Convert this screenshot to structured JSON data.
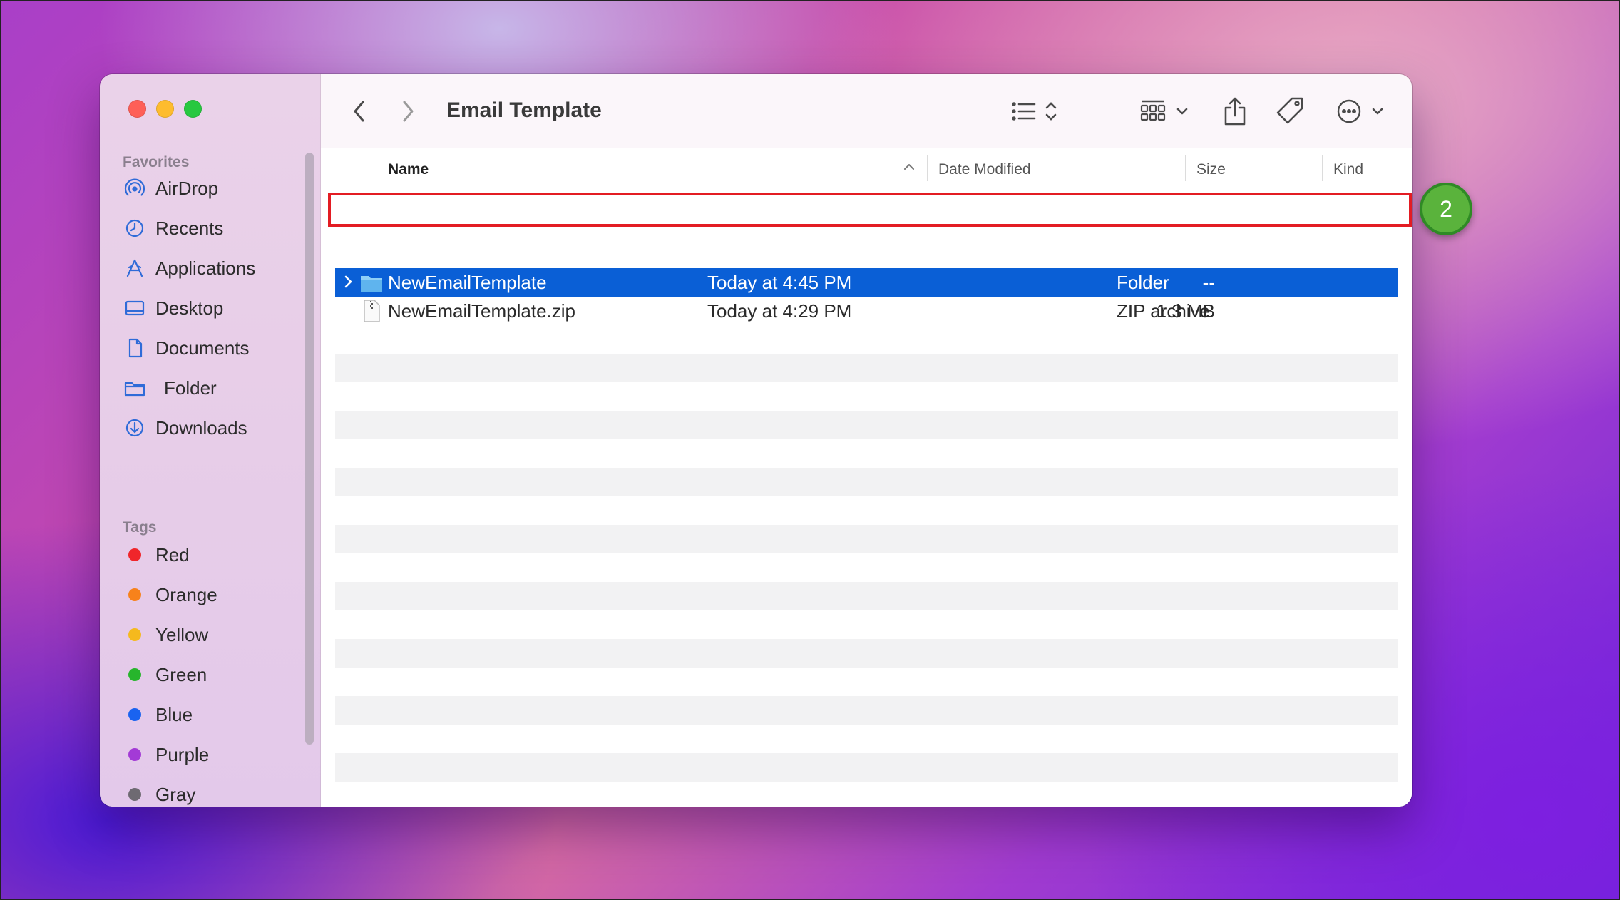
{
  "window": {
    "title": "Email Template"
  },
  "sidebar": {
    "favorites_title": "Favorites",
    "favorites": [
      {
        "label": "AirDrop",
        "icon": "airdrop-icon"
      },
      {
        "label": "Recents",
        "icon": "clock-icon"
      },
      {
        "label": "Applications",
        "icon": "applications-icon"
      },
      {
        "label": "Desktop",
        "icon": "desktop-icon"
      },
      {
        "label": "Documents",
        "icon": "document-icon"
      },
      {
        "label": "Folder",
        "icon": "folder-icon"
      },
      {
        "label": "Downloads",
        "icon": "download-icon"
      }
    ],
    "tags_title": "Tags",
    "tags": [
      {
        "label": "Red",
        "color": "#f0262b"
      },
      {
        "label": "Orange",
        "color": "#f7821b"
      },
      {
        "label": "Yellow",
        "color": "#f5b91d"
      },
      {
        "label": "Green",
        "color": "#27b52c"
      },
      {
        "label": "Blue",
        "color": "#1a63f0"
      },
      {
        "label": "Purple",
        "color": "#a33ad6"
      },
      {
        "label": "Gray",
        "color": "#6e6a72"
      }
    ]
  },
  "columns": {
    "name": "Name",
    "date": "Date Modified",
    "size": "Size",
    "kind": "Kind"
  },
  "files": [
    {
      "name": "NewEmailTemplate",
      "date": "Today at 4:45 PM",
      "size": "--",
      "kind": "Folder",
      "selected": true
    },
    {
      "name": "NewEmailTemplate.zip",
      "date": "Today at 4:29 PM",
      "size": "1.3 MB",
      "kind": "ZIP archive",
      "selected": false
    }
  ],
  "annotation": {
    "step": "2",
    "color": "#e31c23"
  }
}
